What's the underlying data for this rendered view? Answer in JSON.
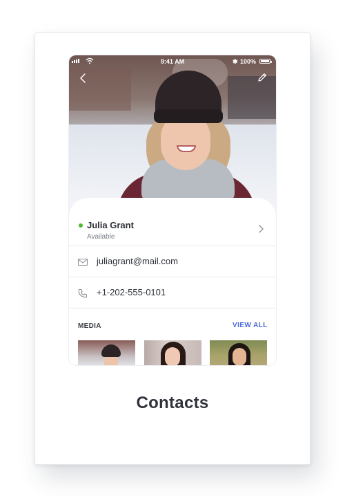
{
  "status_bar": {
    "time": "9:41 AM",
    "battery_percent": "100%",
    "bluetooth_glyph": "✱"
  },
  "contact": {
    "name": "Julia Grant",
    "availability": "Available",
    "online_color": "#4cbb2a",
    "email": "juliagrant@mail.com",
    "phone": "+1-202-555-0101"
  },
  "media": {
    "label": "MEDIA",
    "view_all_label": "VIEW ALL",
    "accent_color": "#4a6ad6",
    "thumbnails": [
      "media-thumb-1",
      "media-thumb-2",
      "media-thumb-3"
    ]
  },
  "icons": {
    "back": "chevron-left-icon",
    "edit": "pencil-icon",
    "email": "envelope-icon",
    "phone": "phone-icon",
    "details": "chevron-right-icon"
  },
  "caption": "Contacts"
}
